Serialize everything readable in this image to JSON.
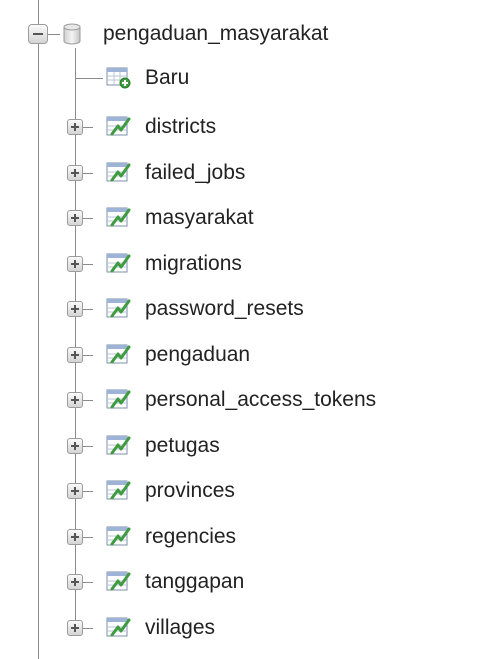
{
  "tree": {
    "database": {
      "name": "pengaduan_masyarakat",
      "expanded": true,
      "icon": "database-icon"
    },
    "new_item": {
      "label": "Baru",
      "icon": "new-table-icon"
    },
    "tables": [
      {
        "name": "districts"
      },
      {
        "name": "failed_jobs"
      },
      {
        "name": "masyarakat"
      },
      {
        "name": "migrations"
      },
      {
        "name": "password_resets"
      },
      {
        "name": "pengaduan"
      },
      {
        "name": "personal_access_tokens"
      },
      {
        "name": "petugas"
      },
      {
        "name": "provinces"
      },
      {
        "name": "regencies"
      },
      {
        "name": "tanggapan"
      },
      {
        "name": "villages"
      }
    ],
    "table_icon": "table-icon",
    "collapsed_icon": "plus-expander-icon",
    "expanded_icon": "minus-expander-icon"
  }
}
